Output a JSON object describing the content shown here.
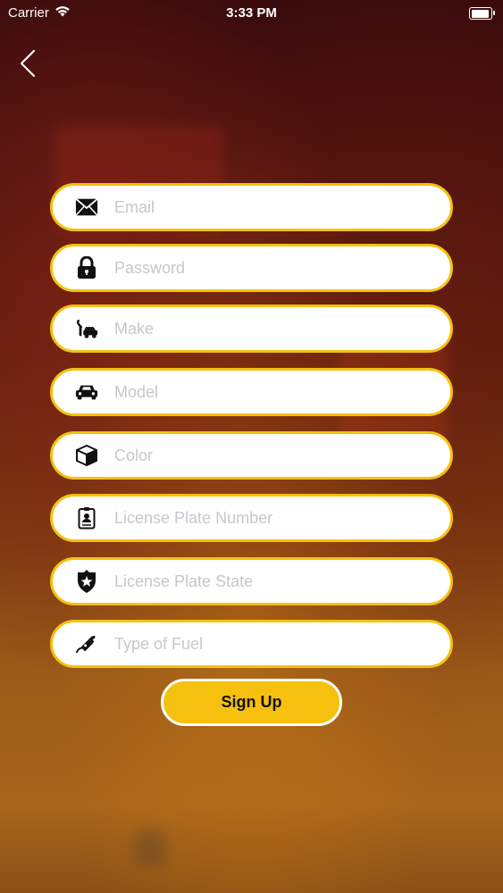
{
  "status_bar": {
    "carrier": "Carrier",
    "time": "3:33 PM",
    "wifi_icon": "wifi-icon",
    "battery_icon": "battery-icon"
  },
  "nav": {
    "back_icon": "chevron-left-icon"
  },
  "form": {
    "fields": [
      {
        "icon": "envelope-icon",
        "placeholder": "Email",
        "value": ""
      },
      {
        "icon": "lock-icon",
        "placeholder": "Password",
        "value": ""
      },
      {
        "icon": "car-wrench-icon",
        "placeholder": "Make",
        "value": ""
      },
      {
        "icon": "car-icon",
        "placeholder": "Model",
        "value": ""
      },
      {
        "icon": "cube-icon",
        "placeholder": "Color",
        "value": ""
      },
      {
        "icon": "id-badge-icon",
        "placeholder": "License Plate Number",
        "value": ""
      },
      {
        "icon": "police-shield-icon",
        "placeholder": "License Plate State",
        "value": ""
      },
      {
        "icon": "fuel-nozzle-icon",
        "placeholder": "Type of Fuel",
        "value": ""
      }
    ],
    "submit_label": "Sign Up"
  },
  "colors": {
    "accent": "#f5c10e",
    "field_bg": "#ffffff",
    "placeholder": "#c7c7cd",
    "status_text": "#ffffff"
  }
}
